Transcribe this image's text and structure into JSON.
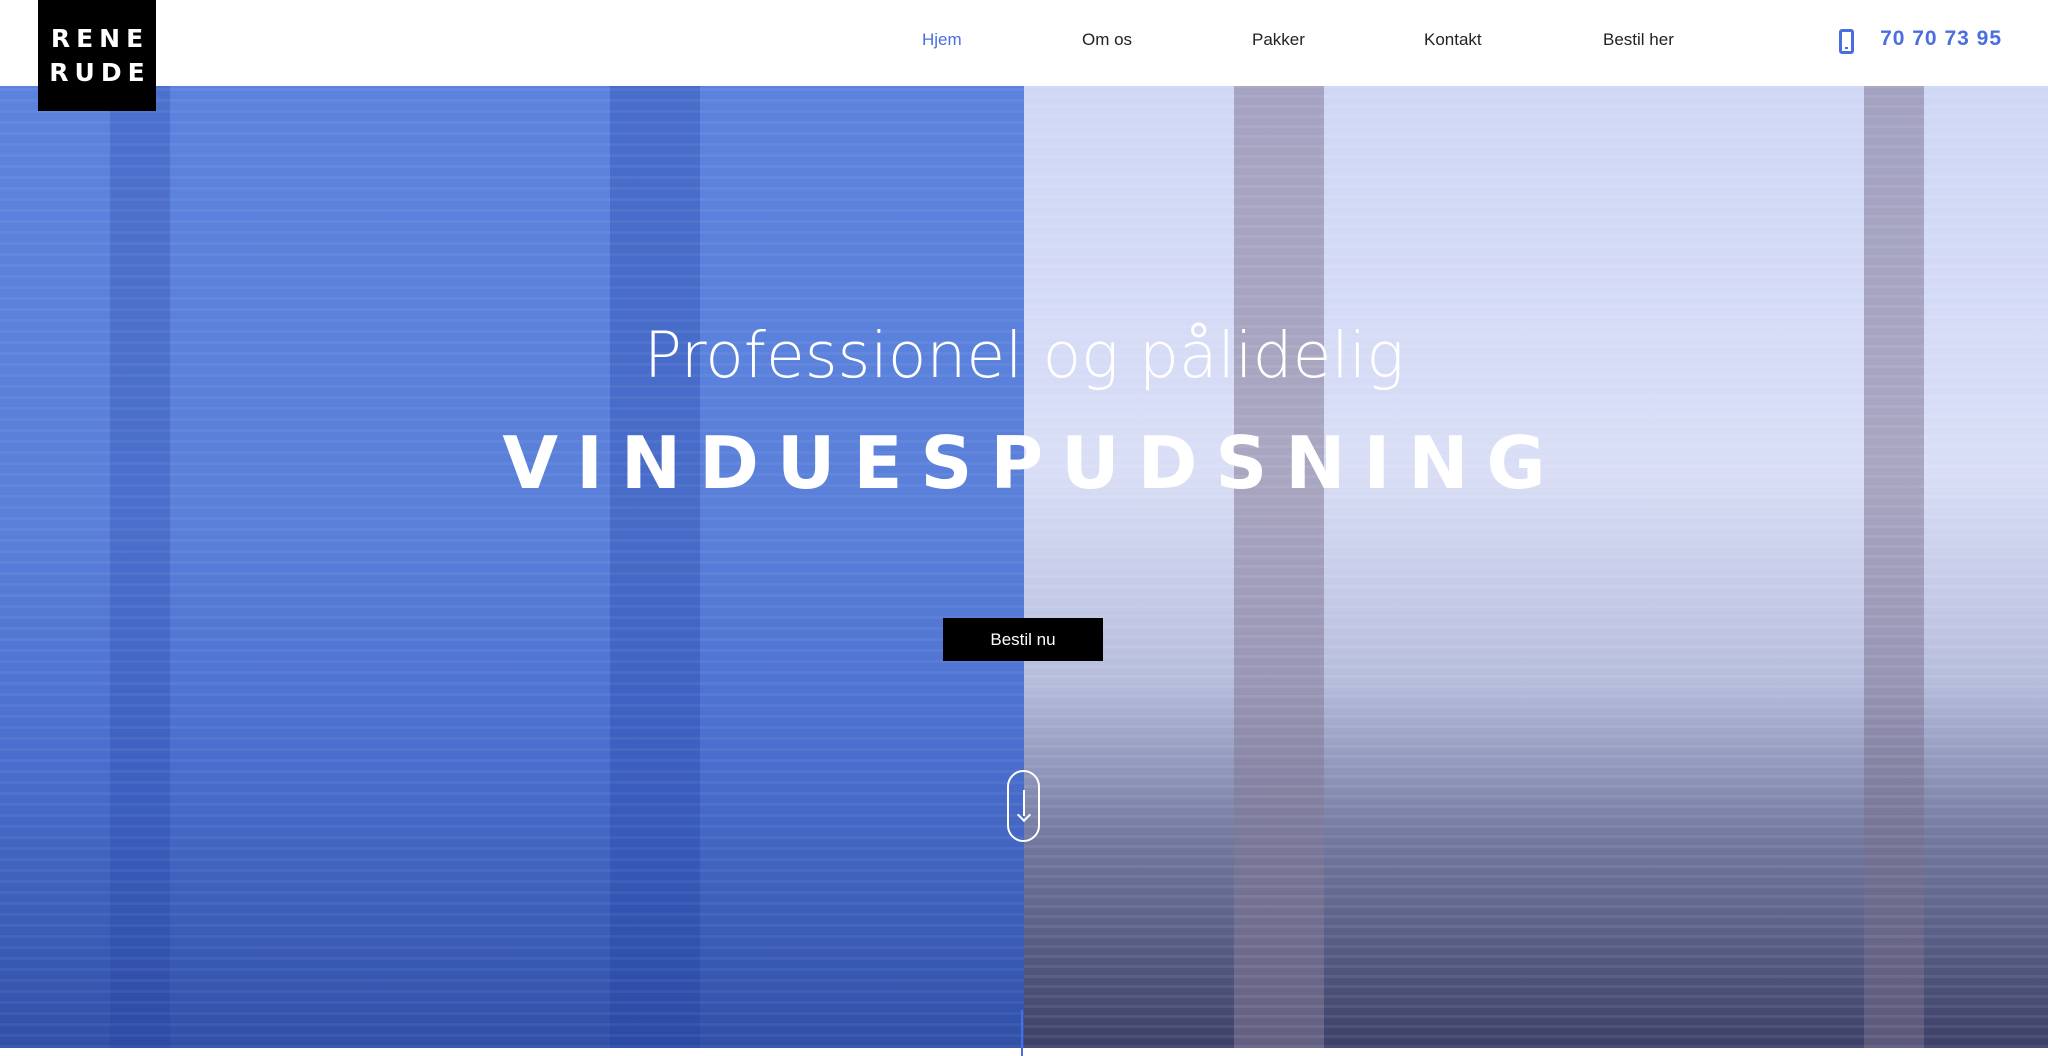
{
  "logo": {
    "line1": "RENE",
    "line2": "RUDE"
  },
  "nav": {
    "items": [
      {
        "label": "Hjem",
        "active": true
      },
      {
        "label": "Om os",
        "active": false
      },
      {
        "label": "Pakker",
        "active": false
      },
      {
        "label": "Kontakt",
        "active": false
      },
      {
        "label": "Bestil her",
        "active": false
      }
    ]
  },
  "phone": {
    "icon": "mobile-phone-icon",
    "number": "70 70 73 95"
  },
  "hero": {
    "subtitle": "Professionel og pålidelig",
    "title": "VINDUESPUDSNING",
    "cta_label": "Bestil nu",
    "scroll_icon": "scroll-down-icon"
  },
  "colors": {
    "accent": "#4a6ee0",
    "hero_left": "#5a80da",
    "hero_right": "#d9def6",
    "button": "#000000"
  }
}
